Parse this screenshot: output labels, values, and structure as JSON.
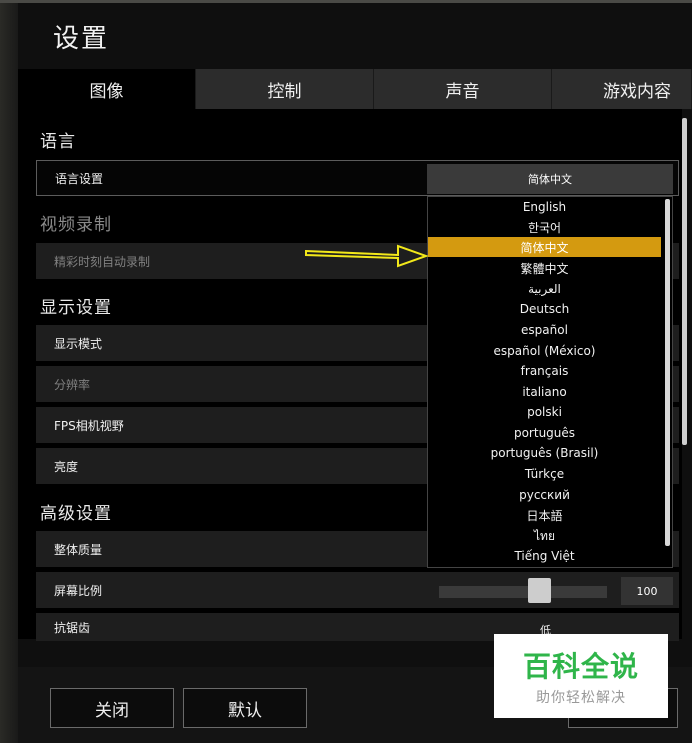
{
  "title": "设置",
  "tabs": [
    {
      "label": "图像",
      "active": true
    },
    {
      "label": "控制",
      "active": false
    },
    {
      "label": "声音",
      "active": false
    },
    {
      "label": "游戏内容",
      "active": false
    }
  ],
  "sections": {
    "language": "语言",
    "video_record": "视频录制",
    "display": "显示设置",
    "advanced": "高级设置"
  },
  "rows": {
    "language_setting": "语言设置",
    "auto_record": "精彩时刻自动录制",
    "display_mode": "显示模式",
    "resolution": "分辨率",
    "fps_fov": "FPS相机视野",
    "brightness": "亮度",
    "overall_quality": "整体质量",
    "screen_scale": "屏幕比例",
    "antialiasing": "抗锯齿"
  },
  "language_select": {
    "value": "简体中文"
  },
  "dropdown_options": [
    "English",
    "한국어",
    "简体中文",
    "繁體中文",
    "العربية",
    "Deutsch",
    "español",
    "español (México)",
    "français",
    "italiano",
    "polski",
    "português",
    "português (Brasil)",
    "Türkçe",
    "русский",
    "日本語",
    "ไทย",
    "Tiếng Việt"
  ],
  "selected_option": "简体中文",
  "screen_scale": {
    "value": "100",
    "level": 0.55
  },
  "antialiasing_value": "低",
  "buttons": {
    "close": "关闭",
    "default": "默认"
  },
  "watermark": {
    "main": "百科全说",
    "sub": "助你轻松解决"
  },
  "colors": {
    "accent": "#d49a10",
    "arrow": "#f2e81a",
    "watermark_green": "#2fb54a"
  }
}
